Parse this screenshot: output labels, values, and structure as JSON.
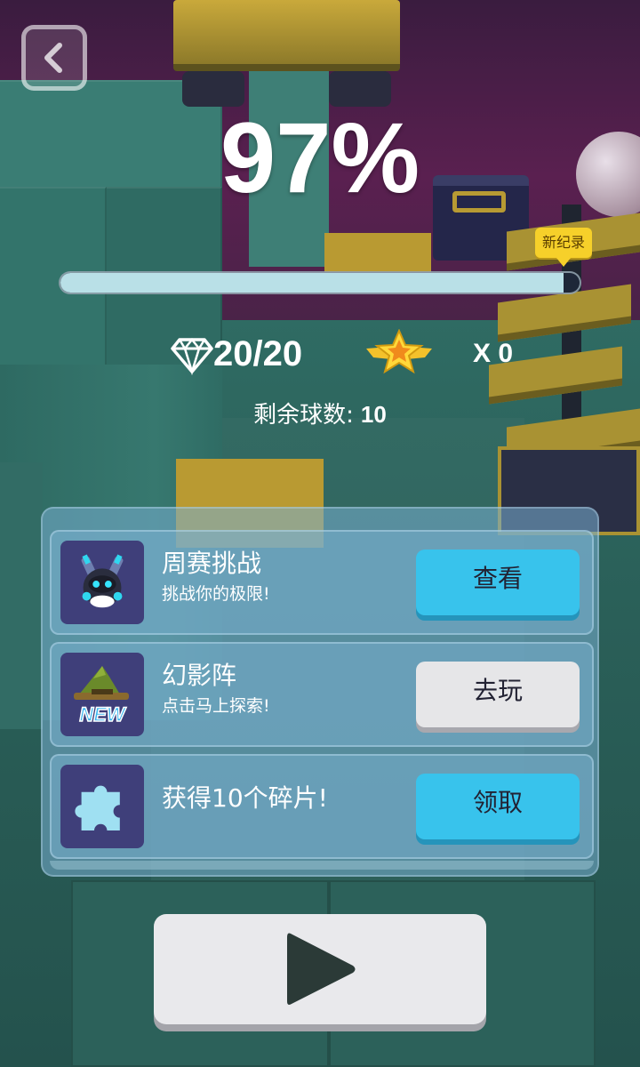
{
  "hud": {
    "back_icon": "chevron-left-icon",
    "progress_percent_text": "97%",
    "progress_fraction": 0.97,
    "record_badge": "新纪录",
    "gems": "20/20",
    "gem_icon": "diamond-icon",
    "star_icon": "winged-star-icon",
    "stars": "X 0",
    "balls_label": "剩余球数:",
    "balls_value": "10"
  },
  "panel": {
    "rows": [
      {
        "icon": "robot-character-icon",
        "title": "周赛挑战",
        "subtitle": "挑战你的极限!",
        "button": "查看",
        "button_style": "blue"
      },
      {
        "icon": "witch-hat-new-icon",
        "icon_text": "NEW",
        "title": "幻影阵",
        "subtitle": "点击马上探索!",
        "button": "去玩",
        "button_style": "gray"
      },
      {
        "icon": "puzzle-piece-icon",
        "title": "获得10个碎片!",
        "subtitle": "",
        "button": "领取",
        "button_style": "blue"
      }
    ]
  },
  "play": {
    "icon": "play-icon"
  },
  "colors": {
    "progress_fill": "#b9e0e7",
    "button_blue": "#38c3ec",
    "button_gray": "#e6e6e8",
    "badge_yellow": "#f6d02a",
    "thumb_bg": "#3f3f7a"
  }
}
